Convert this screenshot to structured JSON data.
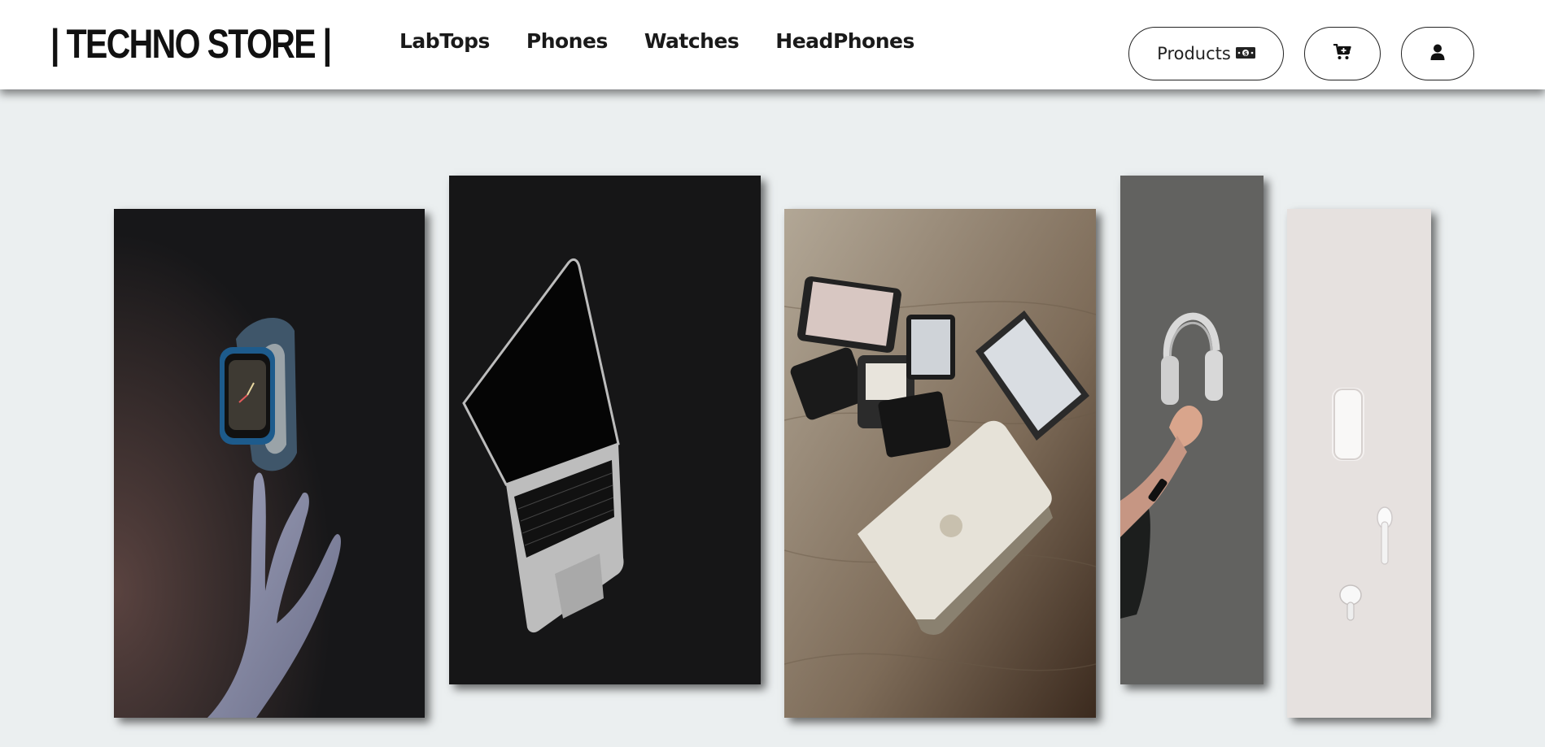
{
  "header": {
    "logo": "| TECHNO STORE |",
    "nav": [
      {
        "label": "LabTops"
      },
      {
        "label": "Phones"
      },
      {
        "label": "Watches"
      },
      {
        "label": "HeadPhones"
      }
    ],
    "products_button": {
      "label": "Products",
      "icon": "money-icon"
    },
    "cart_button": {
      "icon": "cart-plus-icon"
    },
    "user_button": {
      "icon": "user-icon"
    }
  },
  "gallery": [
    {
      "name": "watch-image",
      "alt": "Smart watch floating above hand"
    },
    {
      "name": "laptop-image",
      "alt": "Open laptop on dark background"
    },
    {
      "name": "devices-image",
      "alt": "Phones, tablet and laptop on wooden table"
    },
    {
      "name": "headphones-image",
      "alt": "Hand holding headphones"
    },
    {
      "name": "earbuds-image",
      "alt": "Wireless earbuds and case"
    }
  ],
  "colors": {
    "page_bg": "#ebeff0",
    "header_bg": "#ffffff",
    "text": "#1a1a1a"
  }
}
